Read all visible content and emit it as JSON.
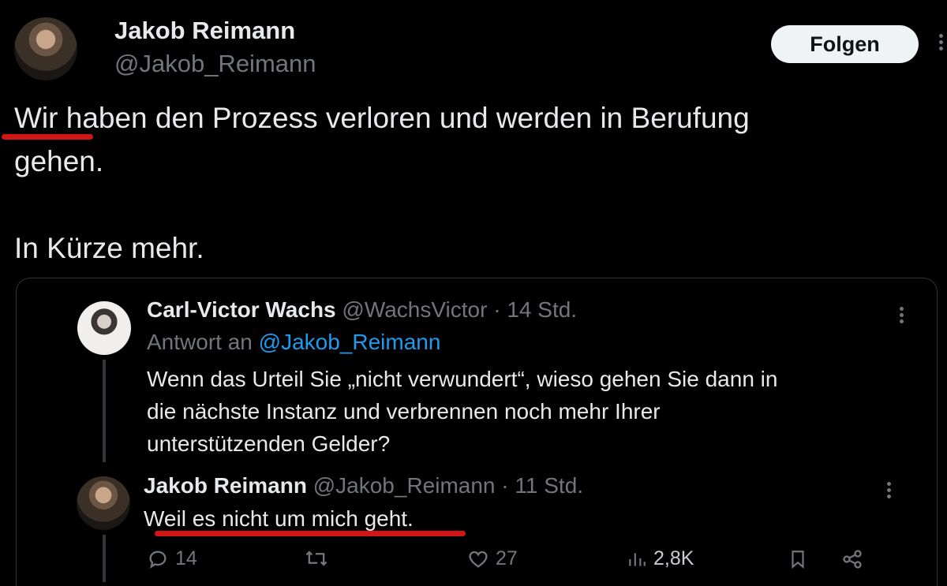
{
  "main_tweet": {
    "author_name": "Jakob Reimann",
    "author_handle": "@Jakob_Reimann",
    "follow_label": "Folgen",
    "text_line_1": "Wir haben den Prozess verloren und werden in Berufung",
    "text_line_2": "gehen.",
    "text_line_3": "In Kürze mehr."
  },
  "quoted_tweet": {
    "author_name": "Carl-Victor Wachs",
    "author_handle": "@WachsVictor",
    "separator": " · ",
    "time": "14 Std.",
    "reply_prefix": "Antwort an ",
    "reply_to": "@Jakob_Reimann",
    "text_line_1": "Wenn das Urteil Sie „nicht verwundert“, wieso gehen Sie dann in",
    "text_line_2": "die nächste Instanz und verbrennen noch mehr Ihrer",
    "text_line_3": "unterstützenden Gelder?"
  },
  "reply_tweet": {
    "author_name": "Jakob Reimann",
    "author_handle": "@Jakob_Reimann",
    "separator": " · ",
    "time": "11 Std.",
    "text": "Weil es nicht um mich geht."
  },
  "actions": {
    "replies": "14",
    "likes": "27",
    "views": "2,8K"
  },
  "colors": {
    "background": "#000000",
    "text": "#e7e9ea",
    "muted": "#71767b",
    "link": "#1d9bf0",
    "annotation_red": "#d01616"
  }
}
